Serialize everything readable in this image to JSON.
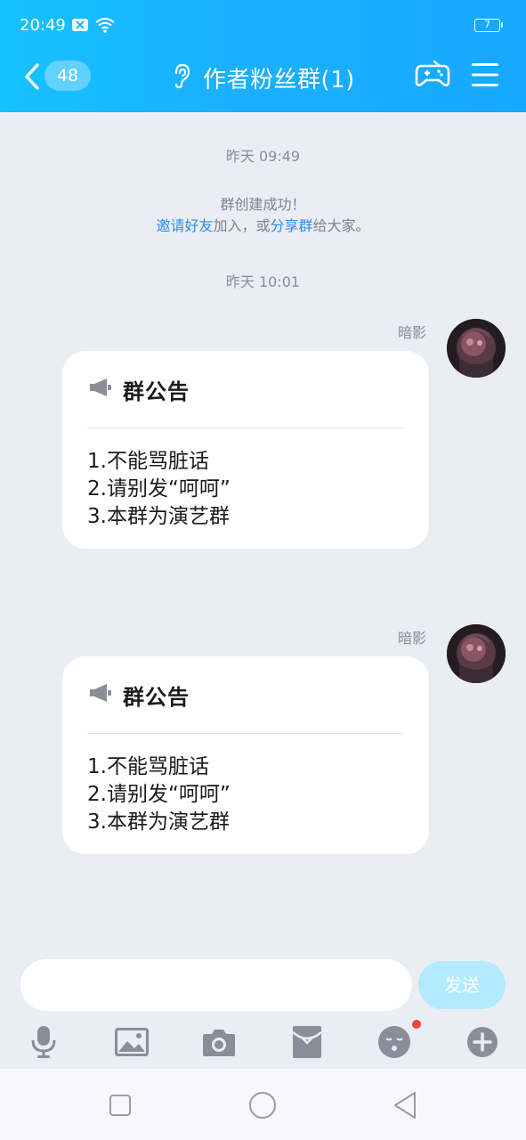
{
  "status_bar": {
    "time": "20:49",
    "battery": "7"
  },
  "header": {
    "back_count": "48",
    "title": "作者粉丝群(1)"
  },
  "chat": {
    "timestamp_1": "昨天 09:49",
    "system": {
      "line1": "群创建成功！",
      "invite_link": "邀请好友",
      "mid_text": "加入，或",
      "share_link": "分享群",
      "end_text": "给大家。"
    },
    "timestamp_2": "昨天 10:01",
    "messages": [
      {
        "sender": "暗影",
        "card_title": "群公告",
        "lines": [
          "1.不能骂脏话",
          "2.请别发“呵呵”",
          "3.本群为演艺群"
        ]
      },
      {
        "sender": "暗影",
        "card_title": "群公告",
        "lines": [
          "1.不能骂脏话",
          "2.请别发“呵呵”",
          "3.本群为演艺群"
        ]
      }
    ]
  },
  "composer": {
    "input_value": "",
    "send_label": "发送"
  },
  "toolbar": {
    "items": [
      "mic-icon",
      "image-icon",
      "camera-icon",
      "red-packet-icon",
      "emoji-icon",
      "plus-icon"
    ]
  },
  "colors": {
    "header": "#17b4ff",
    "link": "#2d8ce8",
    "send_button": "#b2eaff",
    "background": "#ebedf5"
  }
}
